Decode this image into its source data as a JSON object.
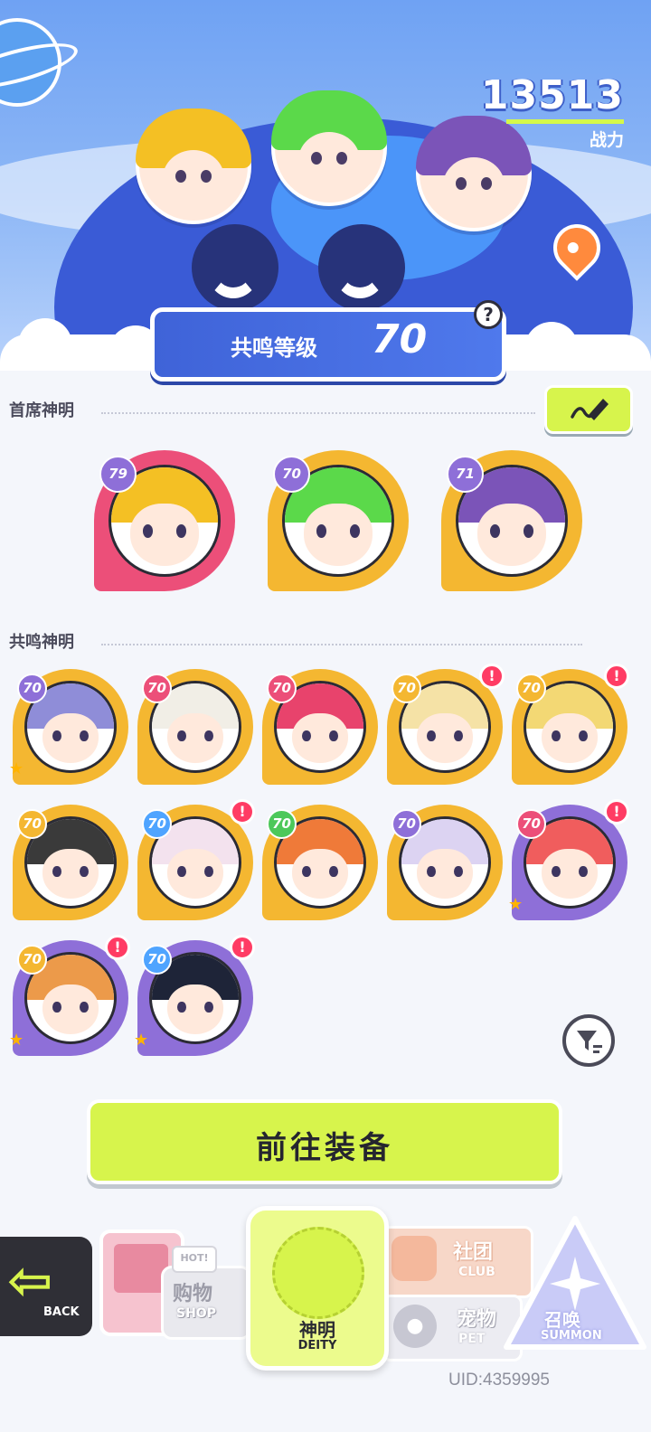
{
  "header": {
    "combat_power_value": "13513",
    "combat_power_label": "战力",
    "resonance_label": "共鸣等级",
    "resonance_level": "70",
    "help_icon_glyph": "?"
  },
  "chief_section": {
    "title": "首席神明",
    "edit_icon": "pencil-icon",
    "deities": [
      {
        "level": "79",
        "theme": "#ec4f79",
        "hair": "#f4c024"
      },
      {
        "level": "70",
        "theme": "#f4b731",
        "hair": "#5bd94a"
      },
      {
        "level": "71",
        "theme": "#f4b731",
        "hair": "#7b54b8"
      }
    ]
  },
  "resonance_section": {
    "title": "共鸣神明",
    "deities": [
      {
        "level": "70",
        "theme": "#f4b731",
        "badge": "#8e6fd8",
        "hair": "#8f8dd8",
        "alert": false,
        "star": true
      },
      {
        "level": "70",
        "theme": "#f4b731",
        "badge": "#ec4f79",
        "hair": "#f1eee6",
        "alert": false,
        "star": false
      },
      {
        "level": "70",
        "theme": "#f4b731",
        "badge": "#ec4f79",
        "hair": "#e8436c",
        "alert": false,
        "star": false
      },
      {
        "level": "70",
        "theme": "#f4b731",
        "badge": "#f4b731",
        "hair": "#f5e2a6",
        "alert": true,
        "star": false
      },
      {
        "level": "70",
        "theme": "#f4b731",
        "badge": "#f4b731",
        "hair": "#f3d874",
        "alert": true,
        "star": false
      },
      {
        "level": "70",
        "theme": "#f4b731",
        "badge": "#f4b731",
        "hair": "#3a3a3a",
        "alert": false,
        "star": false
      },
      {
        "level": "70",
        "theme": "#f4b731",
        "badge": "#4fa4ff",
        "hair": "#f3e2ee",
        "alert": true,
        "star": false
      },
      {
        "level": "70",
        "theme": "#f4b731",
        "badge": "#4cc85a",
        "hair": "#ef7a39",
        "alert": false,
        "star": false
      },
      {
        "level": "70",
        "theme": "#f4b731",
        "badge": "#8e6fd8",
        "hair": "#dcd3f2",
        "alert": false,
        "star": false
      },
      {
        "level": "70",
        "theme": "#8e6fd8",
        "badge": "#ec4f79",
        "hair": "#f05d5d",
        "alert": true,
        "star": true
      },
      {
        "level": "70",
        "theme": "#8e6fd8",
        "badge": "#f4b731",
        "hair": "#ec9a4a",
        "alert": true,
        "star": true
      },
      {
        "level": "70",
        "theme": "#8e6fd8",
        "badge": "#4fa4ff",
        "hair": "#1e2438",
        "alert": true,
        "star": true
      }
    ],
    "alert_glyph": "!"
  },
  "filter_icon": "filter-icon",
  "equip_button_label": "前往装备",
  "nav": {
    "back_label": "BACK",
    "shop_cn": "购物",
    "shop_en": "SHOP",
    "hot_label": "HOT!",
    "deity_cn": "神明",
    "deity_en": "DEITY",
    "club_cn": "社团",
    "club_en": "CLUB",
    "pet_cn": "宠物",
    "pet_en": "PET",
    "summon_cn": "召唤",
    "summon_en": "SUMMON"
  },
  "uid": "UID:4359995",
  "colors": {
    "accent_lime": "#d7f44c",
    "alert_red": "#ff3c64",
    "resonance_blue": "#3f63d8"
  }
}
